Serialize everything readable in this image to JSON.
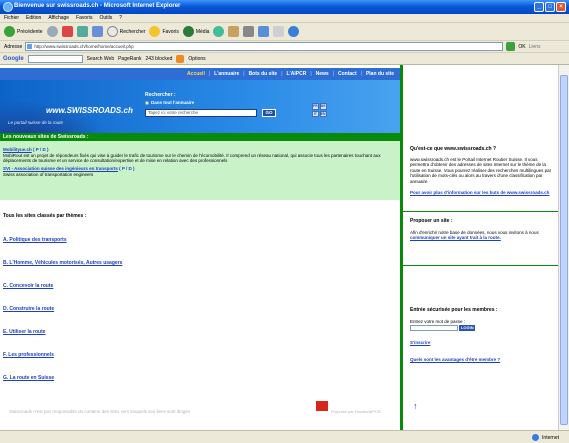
{
  "window": {
    "title": "Bienvenue sur swissroads.ch - Microsoft Internet Explorer"
  },
  "menu": [
    "Fichier",
    "Edition",
    "Affichage",
    "Favoris",
    "Outils",
    "?"
  ],
  "toolbar": {
    "back": "Précédente",
    "search": "Rechercher",
    "favorites": "Favoris",
    "media": "Média"
  },
  "address": {
    "label": "Adresse",
    "url": "http://www.swissroads.ch/home/home/accueil.php",
    "go": "OK",
    "links": "Liens"
  },
  "googlebar": {
    "logo": "Google",
    "search_web": "Search Web",
    "pagerank": "PageRank",
    "blocked": "243 blocked",
    "options": "Options"
  },
  "site": {
    "nav": [
      "Accueil",
      "L'annuaire",
      "Bots du site",
      "L'AIPCR",
      "News",
      "Contact",
      "Plan du site"
    ],
    "logo": {
      "text": "www.SWISSROADS.ch",
      "tagline": "Le portail suisse de la route"
    },
    "search": {
      "label": "Rechercher :",
      "radio": "Dans tout l'annuaire",
      "placeholder": "Tapez ici votre recherche",
      "button": "GO"
    },
    "lang": [
      "FR",
      "DE",
      "IT",
      "EN"
    ],
    "new_sites": {
      "heading": "Les nouveaux sites de Swissroads :",
      "entries": [
        {
          "name": "Mobilityue.ch",
          "pd": "( P / D )",
          "desc": "MobiRout est un projet de répondeurs fixés qui vise à guider le trafic de tourisme sur le chemin de l'écomobilité. Il comprend un réseau national, qui associe tous les partenaires touchant aux déplacements de tourisme et un service de consultation/expertise et de mise en relation avec des professionnels"
        },
        {
          "name": "SVI - Association suisse des ingénieurs en transports",
          "pd": "( P / D )",
          "desc": "Swiss association of transportation engineers"
        }
      ]
    },
    "themes": {
      "title": "Tous les sites classés par thèmes :",
      "items": [
        "A. Politique des transports",
        "B. L'Homme, Véhicules motorisés, Autres usagers",
        "C. Concevoir la route",
        "D. Construire la route",
        "E. Utiliser la route",
        "F. Les professionnels",
        "G. La route en Suisse"
      ]
    },
    "footer": {
      "text": "Swissroads n'est pas responsable du contenu des sites vers lesquels ses liens sont dirigés",
      "logo_text": "Propulsé par Hoodia/AIPCR"
    },
    "right": {
      "what_title": "Qu'est-ce que www.swissroads.ch ?",
      "what_desc": "www.swissroads.ch est le Portail Internet Routier Suisse. Il vous permettra d'obtenir des adresses de sites Internet sur le thème de la route en Suisse. Vous pourrez réaliser des recherches multilingues par l'utilisation de mots-clés ou alors au travers d'une classification par annuaire",
      "what_link": "Pour avoir plus d'information sur les buts de www.swissroads.ch",
      "propose_title": "Proposer un site :",
      "propose_desc": "Afin d'enrichir notre base de données, nous vous invitons à nous",
      "propose_link": "communiquer un site ayant trait à la route.",
      "members_title": "Entrée sécurisée pour les membres :",
      "password_label": "Entrez votre mot de passe :",
      "login_button": "LOGIN",
      "register": "S'inscrire",
      "advantages": "Quels sont les avantages d'être membre ?"
    }
  },
  "status": {
    "zone": "Internet"
  },
  "colors": {
    "nav_blue": "#2e6dd3",
    "green": "#0a8a0a",
    "light_green": "#c9f2c9",
    "link": "#1d3fc2"
  }
}
